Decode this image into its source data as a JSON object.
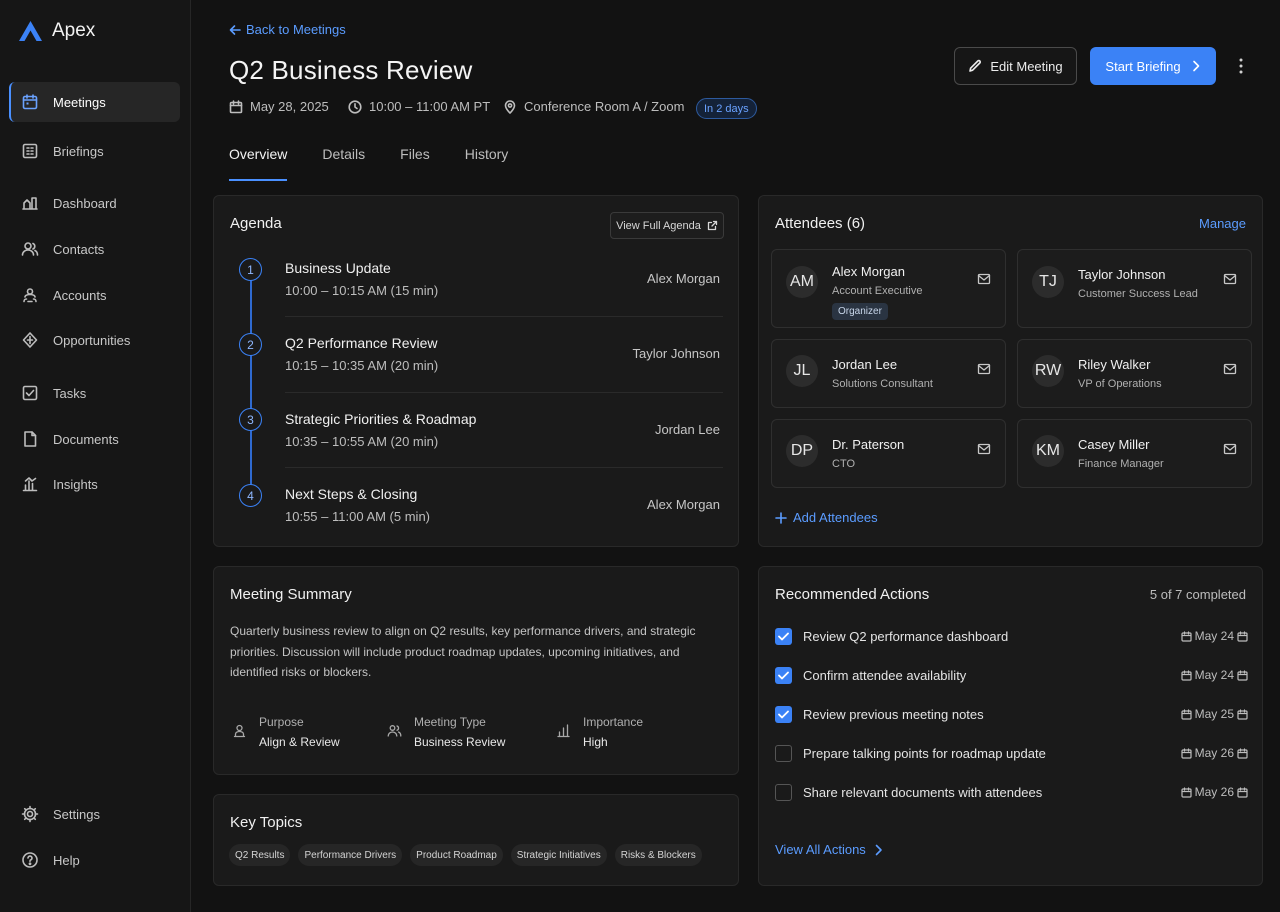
{
  "app": {
    "name": "Apex",
    "accent": "#3b82f6"
  },
  "sidebar": {
    "items": [
      {
        "label": "Meetings",
        "icon": "calendar-icon",
        "active": true
      },
      {
        "label": "Briefings",
        "icon": "briefing-icon"
      },
      {
        "label": "Dashboard",
        "icon": "dashboard-icon"
      },
      {
        "label": "Contacts",
        "icon": "contacts-icon"
      },
      {
        "label": "Accounts",
        "icon": "accounts-icon"
      },
      {
        "label": "Opportunities",
        "icon": "opportunities-icon"
      },
      {
        "label": "Tasks",
        "icon": "tasks-icon"
      },
      {
        "label": "Documents",
        "icon": "document-icon"
      },
      {
        "label": "Insights",
        "icon": "insights-icon"
      }
    ],
    "bottom": [
      {
        "label": "Settings",
        "icon": "gear-icon"
      },
      {
        "label": "Help",
        "icon": "help-icon"
      }
    ]
  },
  "header": {
    "back_label": "Back to Meetings",
    "title": "Q2 Business Review",
    "date": "May 28, 2025",
    "time": "10:00 – 11:00 AM PT",
    "location": "Conference Room A / Zoom",
    "badge": "In 2 days",
    "edit_label": "Edit Meeting",
    "start_label": "Start Briefing"
  },
  "tabs": [
    "Overview",
    "Details",
    "Files",
    "History"
  ],
  "agenda": {
    "title": "Agenda",
    "view_full_label": "View Full Agenda",
    "items": [
      {
        "num": "1",
        "title": "Business Update",
        "time": "10:00 – 10:15 AM (15 min)",
        "owner": "Alex Morgan"
      },
      {
        "num": "2",
        "title": "Q2 Performance Review",
        "time": "10:15 – 10:35 AM (20 min)",
        "owner": "Taylor Johnson"
      },
      {
        "num": "3",
        "title": "Strategic Priorities & Roadmap",
        "time": "10:35 – 10:55 AM (20 min)",
        "owner": "Jordan Lee"
      },
      {
        "num": "4",
        "title": "Next Steps & Closing",
        "time": "10:55 – 11:00 AM (5 min)",
        "owner": "Alex Morgan"
      }
    ]
  },
  "attendees": {
    "title": "Attendees (6)",
    "manage_label": "Manage",
    "add_label": "Add Attendees",
    "people": [
      {
        "initials": "AM",
        "name": "Alex Morgan",
        "role": "Account Executive",
        "badge": "Organizer"
      },
      {
        "initials": "TJ",
        "name": "Taylor Johnson",
        "role": "Customer Success Lead"
      },
      {
        "initials": "JL",
        "name": "Jordan Lee",
        "role": "Solutions Consultant"
      },
      {
        "initials": "RW",
        "name": "Riley Walker",
        "role": "VP of Operations"
      },
      {
        "initials": "DP",
        "name": "Dr. Paterson",
        "role": "CTO"
      },
      {
        "initials": "KM",
        "name": "Casey Miller",
        "role": "Finance Manager"
      }
    ]
  },
  "summary": {
    "title": "Meeting Summary",
    "text": "Quarterly business review to align on Q2 results, key performance drivers, and strategic priorities. Discussion will include product roadmap updates, upcoming initiatives, and identified risks or blockers.",
    "fields": [
      {
        "label": "Purpose",
        "value": "Align & Review",
        "icon": "purpose-icon"
      },
      {
        "label": "Meeting Type",
        "value": "Business Review",
        "icon": "people-icon"
      },
      {
        "label": "Importance",
        "value": "High",
        "icon": "bar-chart-icon"
      }
    ]
  },
  "topics": {
    "title": "Key Topics",
    "items": [
      "Q2 Results",
      "Performance Drivers",
      "Product Roadmap",
      "Strategic Initiatives",
      "Risks & Blockers"
    ]
  },
  "actions": {
    "title": "Recommended Actions",
    "count": "5 of 7 completed",
    "view_all_label": "View All Actions",
    "items": [
      {
        "label": "Review Q2 performance dashboard",
        "date": "May 24",
        "done": true
      },
      {
        "label": "Confirm attendee availability",
        "date": "May 24",
        "done": true
      },
      {
        "label": "Review previous meeting notes",
        "date": "May 25",
        "done": true
      },
      {
        "label": "Prepare talking points for roadmap update",
        "date": "May 26",
        "done": false
      },
      {
        "label": "Share relevant documents with attendees",
        "date": "May 26",
        "done": false
      }
    ]
  }
}
